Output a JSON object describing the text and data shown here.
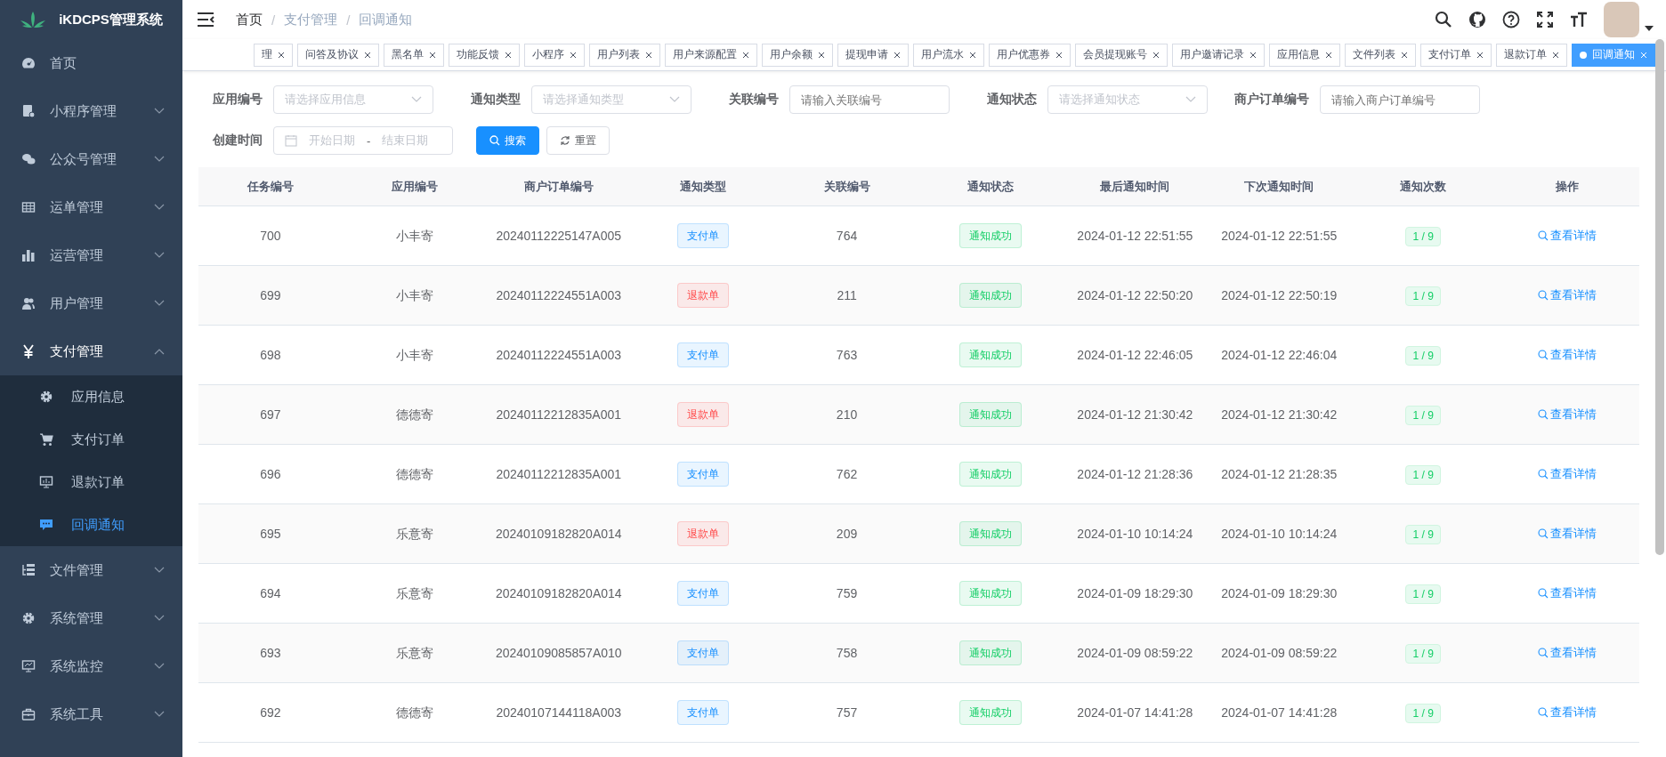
{
  "app": {
    "title": "iKDCPS管理系统"
  },
  "breadcrumb": [
    {
      "label": "首页",
      "link": false
    },
    {
      "separator": "/",
      "label": "支付管理",
      "link": true
    },
    {
      "separator": "/",
      "label": "回调通知",
      "link": true
    }
  ],
  "sidebar": {
    "items": [
      {
        "label": "首页",
        "expanded": false,
        "has_children": false
      },
      {
        "label": "小程序管理",
        "expanded": false,
        "has_children": true
      },
      {
        "label": "公众号管理",
        "expanded": false,
        "has_children": true
      },
      {
        "label": "运单管理",
        "expanded": false,
        "has_children": true
      },
      {
        "label": "运营管理",
        "expanded": false,
        "has_children": true
      },
      {
        "label": "用户管理",
        "expanded": false,
        "has_children": true
      },
      {
        "label": "支付管理",
        "expanded": true,
        "has_children": true,
        "children": [
          {
            "label": "应用信息",
            "selected": false
          },
          {
            "label": "支付订单",
            "selected": false
          },
          {
            "label": "退款订单",
            "selected": false
          },
          {
            "label": "回调通知",
            "selected": true
          }
        ]
      },
      {
        "label": "文件管理",
        "expanded": false,
        "has_children": true
      },
      {
        "label": "系统管理",
        "expanded": false,
        "has_children": true
      },
      {
        "label": "系统监控",
        "expanded": false,
        "has_children": true
      },
      {
        "label": "系统工具",
        "expanded": false,
        "has_children": true
      }
    ]
  },
  "tags": [
    {
      "label": "理",
      "selected": false
    },
    {
      "label": "问答及协议",
      "selected": false
    },
    {
      "label": "黑名单",
      "selected": false
    },
    {
      "label": "功能反馈",
      "selected": false
    },
    {
      "label": "小程序",
      "selected": false
    },
    {
      "label": "用户列表",
      "selected": false
    },
    {
      "label": "用户来源配置",
      "selected": false
    },
    {
      "label": "用户余额",
      "selected": false
    },
    {
      "label": "提现申请",
      "selected": false
    },
    {
      "label": "用户流水",
      "selected": false
    },
    {
      "label": "用户优惠券",
      "selected": false
    },
    {
      "label": "会员提现账号",
      "selected": false
    },
    {
      "label": "用户邀请记录",
      "selected": false
    },
    {
      "label": "应用信息",
      "selected": false
    },
    {
      "label": "文件列表",
      "selected": false
    },
    {
      "label": "支付订单",
      "selected": false
    },
    {
      "label": "退款订单",
      "selected": false
    },
    {
      "label": "回调通知",
      "selected": true
    }
  ],
  "filters": [
    {
      "kind": "select",
      "label": "应用编号",
      "placeholder": "请选择应用信息"
    },
    {
      "kind": "select",
      "label": "通知类型",
      "placeholder": "请选择通知类型"
    },
    {
      "kind": "input",
      "label": "关联编号",
      "placeholder": "请输入关联编号"
    },
    {
      "kind": "select",
      "label": "通知状态",
      "placeholder": "请选择通知状态"
    },
    {
      "kind": "input",
      "label": "商户订单编号",
      "placeholder": "请输入商户订单编号"
    },
    {
      "kind": "daterange",
      "label": "创建时间",
      "start_placeholder": "开始日期",
      "separator": "-",
      "end_placeholder": "结束日期"
    }
  ],
  "buttons": [
    {
      "kind": "primary",
      "label": "搜索"
    },
    {
      "kind": "default",
      "label": "重置"
    }
  ],
  "table": {
    "columns": [
      "任务编号",
      "应用编号",
      "商户订单编号",
      "通知类型",
      "关联编号",
      "通知状态",
      "最后通知时间",
      "下次通知时间",
      "通知次数",
      "操作"
    ],
    "rows": [
      {
        "id": "700",
        "app": "小丰寄",
        "order_no": "20240112225147A005",
        "type": {
          "text": "支付单",
          "color": "#1890ff"
        },
        "ref": "764",
        "status": {
          "text": "通知成功",
          "color": "#13ce66"
        },
        "last": "2024-01-12 22:51:55",
        "next": "2024-01-12 22:51:55",
        "count": "1 / 9",
        "action": "查看详情"
      },
      {
        "id": "699",
        "app": "小丰寄",
        "order_no": "20240112224551A003",
        "type": {
          "text": "退款单",
          "color": "#ff4949"
        },
        "ref": "211",
        "status": {
          "text": "通知成功",
          "color": "#13ce66"
        },
        "last": "2024-01-12 22:50:20",
        "next": "2024-01-12 22:50:19",
        "count": "1 / 9",
        "action": "查看详情"
      },
      {
        "id": "698",
        "app": "小丰寄",
        "order_no": "20240112224551A003",
        "type": {
          "text": "支付单",
          "color": "#1890ff"
        },
        "ref": "763",
        "status": {
          "text": "通知成功",
          "color": "#13ce66"
        },
        "last": "2024-01-12 22:46:05",
        "next": "2024-01-12 22:46:04",
        "count": "1 / 9",
        "action": "查看详情"
      },
      {
        "id": "697",
        "app": "德德寄",
        "order_no": "20240112212835A001",
        "type": {
          "text": "退款单",
          "color": "#ff4949"
        },
        "ref": "210",
        "status": {
          "text": "通知成功",
          "color": "#13ce66"
        },
        "last": "2024-01-12 21:30:42",
        "next": "2024-01-12 21:30:42",
        "count": "1 / 9",
        "action": "查看详情"
      },
      {
        "id": "696",
        "app": "德德寄",
        "order_no": "20240112212835A001",
        "type": {
          "text": "支付单",
          "color": "#1890ff"
        },
        "ref": "762",
        "status": {
          "text": "通知成功",
          "color": "#13ce66"
        },
        "last": "2024-01-12 21:28:36",
        "next": "2024-01-12 21:28:35",
        "count": "1 / 9",
        "action": "查看详情"
      },
      {
        "id": "695",
        "app": "乐意寄",
        "order_no": "20240109182820A014",
        "type": {
          "text": "退款单",
          "color": "#ff4949"
        },
        "ref": "209",
        "status": {
          "text": "通知成功",
          "color": "#13ce66"
        },
        "last": "2024-01-10 10:14:24",
        "next": "2024-01-10 10:14:24",
        "count": "1 / 9",
        "action": "查看详情"
      },
      {
        "id": "694",
        "app": "乐意寄",
        "order_no": "20240109182820A014",
        "type": {
          "text": "支付单",
          "color": "#1890ff"
        },
        "ref": "759",
        "status": {
          "text": "通知成功",
          "color": "#13ce66"
        },
        "last": "2024-01-09 18:29:30",
        "next": "2024-01-09 18:29:30",
        "count": "1 / 9",
        "action": "查看详情"
      },
      {
        "id": "693",
        "app": "乐意寄",
        "order_no": "20240109085857A010",
        "type": {
          "text": "支付单",
          "color": "#1890ff"
        },
        "ref": "758",
        "status": {
          "text": "通知成功",
          "color": "#13ce66"
        },
        "last": "2024-01-09 08:59:22",
        "next": "2024-01-09 08:59:22",
        "count": "1 / 9",
        "action": "查看详情"
      },
      {
        "id": "692",
        "app": "德德寄",
        "order_no": "20240107144118A003",
        "type": {
          "text": "支付单",
          "color": "#1890ff"
        },
        "ref": "757",
        "status": {
          "text": "通知成功",
          "color": "#13ce66"
        },
        "last": "2024-01-07 14:41:28",
        "next": "2024-01-07 14:41:28",
        "count": "1 / 9",
        "action": "查看详情"
      }
    ]
  }
}
